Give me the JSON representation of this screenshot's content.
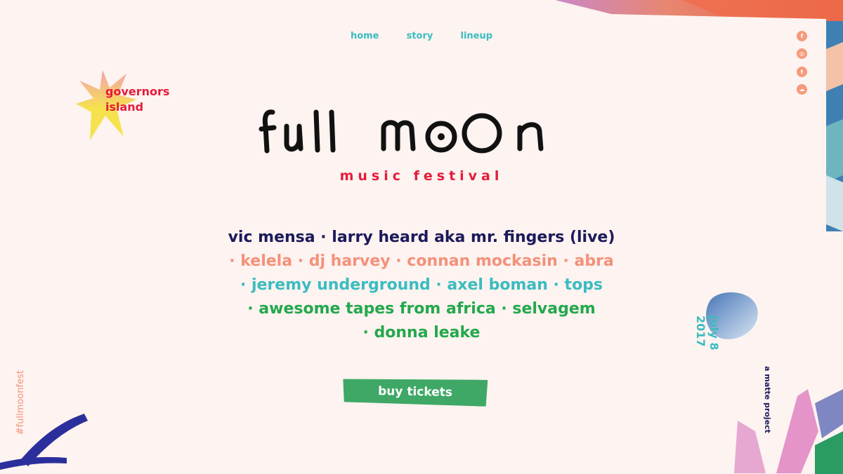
{
  "nav": {
    "home": "home",
    "story": "story",
    "lineup": "lineup"
  },
  "social": {
    "facebook": "f",
    "instagram": "◎",
    "twitter": "t",
    "soundcloud": "☁"
  },
  "badge": {
    "line1": "governors",
    "line2": "island"
  },
  "logo": {
    "title": "full moon",
    "subtitle": "music festival"
  },
  "lineup": [
    "vic mensa · larry heard aka mr. fingers (live)",
    "· kelela · dj harvey · connan mockasin · abra",
    "· jeremy underground · axel boman · tops",
    "· awesome tapes from africa · selvagem",
    "· donna leake"
  ],
  "date": {
    "line1": "july 8",
    "line2": "2017"
  },
  "cta": {
    "tickets": "buy tickets"
  },
  "footer": {
    "hashtag": "#fullmoonfest",
    "credit": "a matte project"
  },
  "colors": {
    "background": "#fdf3f0",
    "teal": "#3bbcbf",
    "red": "#e61b3a",
    "navy": "#1c1a5b",
    "salmon": "#f4917a",
    "green": "#23a84c"
  }
}
